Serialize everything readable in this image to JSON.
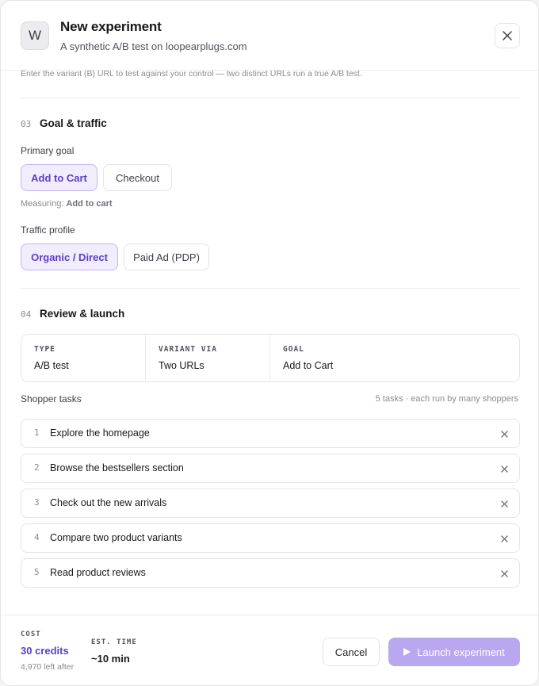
{
  "header": {
    "avatar_letter": "W",
    "title": "New experiment",
    "subtitle": "A synthetic A/B test on loopearplugs.com"
  },
  "hint_text": "Enter the variant (B) URL to test against your control — two distinct URLs run a true A/B test.",
  "goal_section": {
    "number": "03",
    "title": "Goal & traffic",
    "primary_goal_label": "Primary goal",
    "goal_options": [
      {
        "label": "Add to Cart",
        "selected": true
      },
      {
        "label": "Checkout",
        "selected": false
      }
    ],
    "measuring_prefix": "Measuring:",
    "measuring_value": "Add to cart",
    "traffic_label": "Traffic profile",
    "traffic_options": [
      {
        "label": "Organic / Direct",
        "selected": true
      },
      {
        "label": "Paid Ad (PDP)",
        "selected": false
      }
    ]
  },
  "review_section": {
    "number": "04",
    "title": "Review & launch",
    "summary": [
      {
        "key": "TYPE",
        "value": "A/B test"
      },
      {
        "key": "VARIANT VIA",
        "value": "Two URLs"
      },
      {
        "key": "GOAL",
        "value": "Add to Cart"
      }
    ],
    "tasks_label": "Shopper tasks",
    "tasks_meta": "5 tasks · each run by many shoppers",
    "tasks": [
      {
        "num": "1",
        "text": "Explore the homepage"
      },
      {
        "num": "2",
        "text": "Browse the bestsellers section"
      },
      {
        "num": "3",
        "text": "Check out the new arrivals"
      },
      {
        "num": "4",
        "text": "Compare two product variants"
      },
      {
        "num": "5",
        "text": "Read product reviews"
      }
    ]
  },
  "footer": {
    "cost_key": "COST",
    "cost_value": "30 credits",
    "cost_sub": "4,970 left after",
    "time_key": "EST. TIME",
    "time_value": "~10 min",
    "cancel_label": "Cancel",
    "launch_label": "Launch experiment"
  },
  "colors": {
    "accent": "#5b3fc4",
    "accent_soft": "#f1edfc",
    "launch_disabled": "#b9a7ef"
  }
}
